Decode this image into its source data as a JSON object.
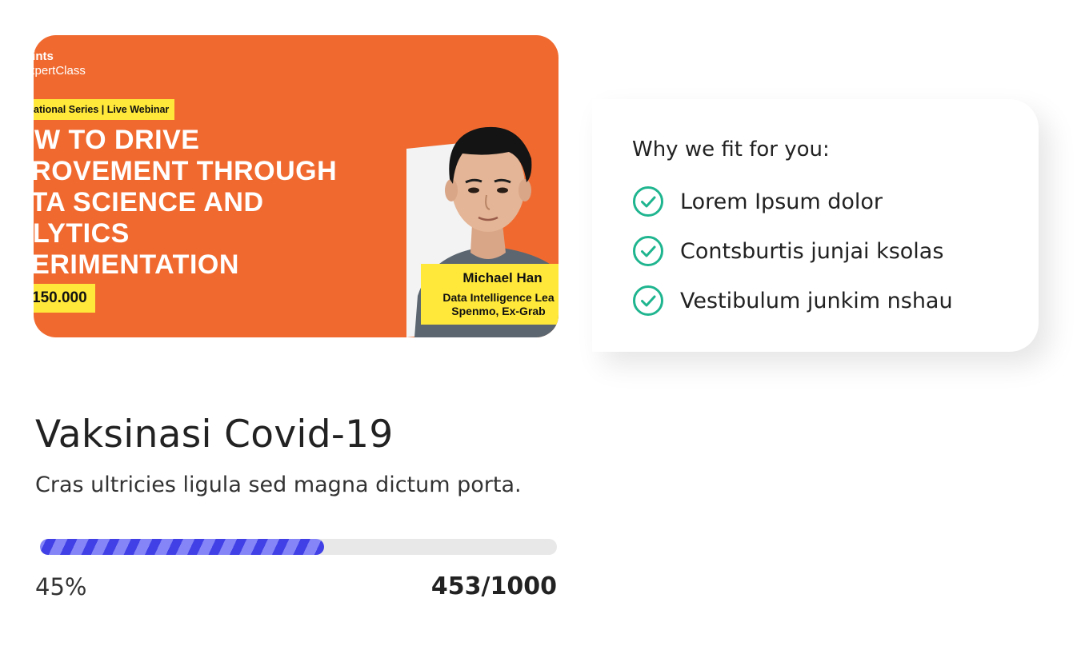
{
  "banner": {
    "brand_line1": "lints",
    "brand_line2": "xpertClass",
    "series_tag": "ational Series | Live Webinar",
    "headline_lines": [
      "OW TO DRIVE",
      "PROVEMENT THROUGH",
      "ATA SCIENCE AND",
      "ALYTICS",
      "PERIMENTATION"
    ],
    "price": "150.000",
    "speaker_name": "Michael Han",
    "speaker_role_line1": "Data Intelligence Lea",
    "speaker_role_line2": "Spenmo, Ex-Grab",
    "colors": {
      "background": "#f06a30",
      "tag": "#ffe83a"
    }
  },
  "features": {
    "title": "Why we fit for you:",
    "items": [
      {
        "label": "Lorem Ipsum dolor",
        "icon": "check-circle-icon"
      },
      {
        "label": "Contsburtis junjai ksolas",
        "icon": "check-circle-icon"
      },
      {
        "label": "Vestibulum junkim nshau",
        "icon": "check-circle-icon"
      }
    ],
    "check_color": "#1fb58f"
  },
  "course": {
    "title": "Vaksinasi Covid-19",
    "description": "Cras ultricies ligula sed magna dictum porta.",
    "progress_fraction": 0.55,
    "progress_percent_label": "45%",
    "count_label": "453/1000",
    "progress_colors": {
      "dark": "#4040e6",
      "light": "#8585f7",
      "track": "#e8e8e8"
    }
  }
}
